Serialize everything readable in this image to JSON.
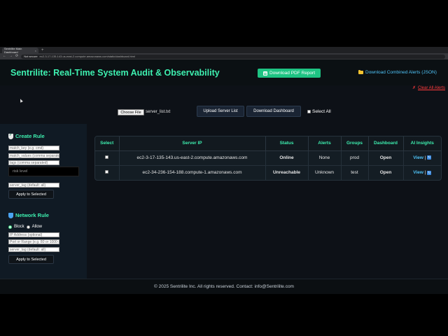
{
  "browser": {
    "tab_title": "Sentrilite Main Dashboard",
    "tab_close": "×",
    "new_tab": "+",
    "not_secure": "Not secure",
    "url": "ec2-3-17-135-143.us-east-2.compute.amazonaws.com/static/dashboard.html",
    "back": "←",
    "forward": "→",
    "reload": "⟳"
  },
  "header": {
    "title": "Sentrilite: Real-Time System Audit & Observability",
    "pdf_button": "Download PDF Report",
    "json_link": "Download Combined Alerts (JSON)",
    "clear_link": "Clear All Alerts",
    "clear_icon": "✗"
  },
  "toolbar": {
    "choose_file": "Choose File",
    "file_name": "server_list.txt",
    "upload_button": "Upload Server List",
    "download_dashboard_button": "Download Dashboard",
    "select_all_label": "Select All"
  },
  "sidebar": {
    "create_rule": {
      "title": "Create Rule",
      "match_key_placeholder": "match_key (e.g. cmd)",
      "match_values_placeholder": "match_values (comma separated)",
      "tags_placeholder": "tags (comma separated)",
      "risk_level_placeholder": "risk level",
      "server_tag_placeholder": "server_tag (default: all)",
      "apply_button": "Apply to Selected"
    },
    "network_rule": {
      "title": "Network Rule",
      "block_label": "Block",
      "allow_label": "Allow",
      "ip_placeholder": "IP Address (optional)",
      "port_placeholder": "Port or Range (e.g. 80 or 1000-2000)",
      "server_tag_placeholder": "server_tag (default: all)",
      "apply_button": "Apply to Selected"
    }
  },
  "table": {
    "columns": [
      "Select",
      "Server IP",
      "Status",
      "Alerts",
      "Groups",
      "Dashboard",
      "AI Insights"
    ],
    "rows": [
      {
        "server_ip": "ec2-3-17-135-143.us-east-2.compute.amazonaws.com",
        "status": "Online",
        "alerts": "None",
        "groups": "prod",
        "dashboard": "Open",
        "ai_view": "View",
        "separator": "|"
      },
      {
        "server_ip": "ec2-34-236-154-188.compute-1.amazonaws.com",
        "status": "Unreachable",
        "alerts": "Unknown",
        "groups": "test",
        "dashboard": "Open",
        "ai_view": "View",
        "separator": "|"
      }
    ]
  },
  "footer": {
    "text": "© 2025 Sentrilite Inc. All rights reserved. Contact: info@Sentrilite.com"
  },
  "colors": {
    "accent": "#3ef0b0",
    "online": "#3ddc84",
    "unreachable": "#ff4b4b",
    "link": "#4fc3f7",
    "danger": "#ff3b3b"
  },
  "icons": [
    "shield-check-icon",
    "shield-icon",
    "folder-icon",
    "pdf-icon",
    "refresh-icon"
  ]
}
